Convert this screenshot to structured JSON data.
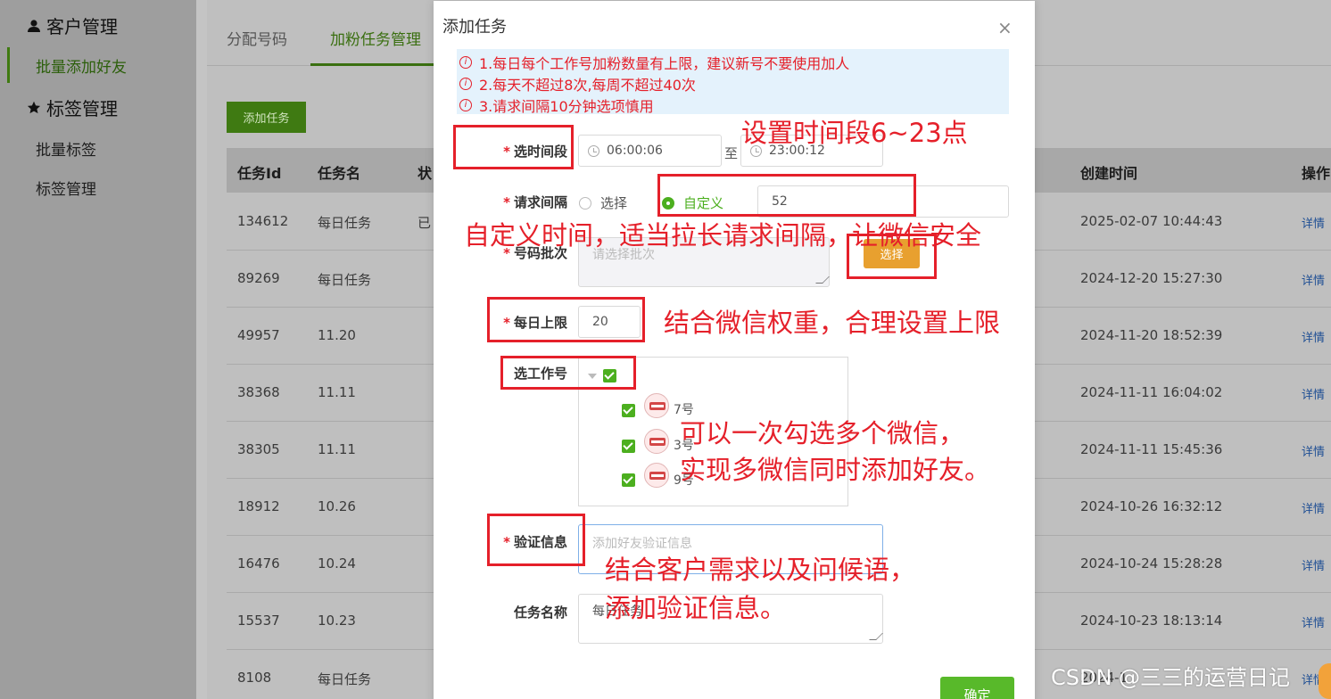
{
  "sidebar": {
    "groups": [
      {
        "label": "客户管理",
        "icon": "user-icon",
        "items": [
          "批量添加好友"
        ]
      },
      {
        "label": "标签管理",
        "icon": "star-icon",
        "items": [
          "批量标签",
          "标签管理"
        ]
      }
    ],
    "active_item": "批量添加好友"
  },
  "tabs": [
    "分配号码",
    "加粉任务管理"
  ],
  "active_tab": "加粉任务管理",
  "toolbar": {
    "add_task_label": "添加任务"
  },
  "table": {
    "headers": {
      "id": "任务Id",
      "name": "任务名",
      "status": "状",
      "created": "创建时间",
      "action": "操作"
    },
    "rows": [
      {
        "id": "134612",
        "name": "每日任务",
        "status": "已",
        "created": "2025-02-07 10:44:43",
        "action": "详情"
      },
      {
        "id": "89269",
        "name": "每日任务",
        "status": "",
        "created": "2024-12-20 15:27:30",
        "action": "详情"
      },
      {
        "id": "49957",
        "name": "11.20",
        "status": "",
        "created": "2024-11-20 18:52:39",
        "action": "详情"
      },
      {
        "id": "38368",
        "name": "11.11",
        "status": "",
        "created": "2024-11-11 16:04:02",
        "action": "详情"
      },
      {
        "id": "38305",
        "name": "11.11",
        "status": "",
        "created": "2024-11-11 15:45:36",
        "action": "详情"
      },
      {
        "id": "18912",
        "name": "10.26",
        "status": "",
        "created": "2024-10-26 16:32:12",
        "action": "详情"
      },
      {
        "id": "16476",
        "name": "10.24",
        "status": "",
        "created": "2024-10-24 15:28:28",
        "action": "详情"
      },
      {
        "id": "15537",
        "name": "10.23",
        "status": "",
        "created": "2024-10-23 18:13:14",
        "action": "详情"
      },
      {
        "id": "8108",
        "name": "每日任务",
        "status": "",
        "created": "2024-1",
        "action": "详情"
      }
    ]
  },
  "modal": {
    "title": "添加任务",
    "close_icon": "close-icon",
    "notices": [
      "1.每日每个工作号加粉数量有上限，建议新号不要使用加人",
      "2.每天不超过8次,每周不超过40次",
      "3.请求间隔10分钟选项慎用"
    ],
    "fields": {
      "time_range": {
        "label": "选时间段",
        "start": "06:00:06",
        "separator": "至",
        "end": "23:00:12"
      },
      "interval": {
        "label": "请求间隔",
        "option_select": "选择",
        "option_custom": "自定义",
        "value": "52"
      },
      "batch": {
        "label": "号码批次",
        "placeholder": "请选择批次",
        "button": "选择"
      },
      "daily_limit": {
        "label": "每日上限",
        "value": "20"
      },
      "accounts": {
        "label": "选工作号",
        "items": [
          "7号",
          "3号",
          "9号"
        ]
      },
      "verify": {
        "label": "验证信息",
        "placeholder": "添加好友验证信息"
      },
      "task_name": {
        "label": "任务名称",
        "value": "每日任务"
      }
    },
    "confirm_label": "确定"
  },
  "annotations": [
    "设置时间段6~23点",
    "自定义时间，适当拉长请求间隔，让微信安全",
    "结合微信权重，合理设置上限",
    "可以一次勾选多个微信，",
    "实现多微信同时添加好友。",
    "结合客户需求以及问候语，",
    "添加验证信息。"
  ],
  "watermark": "CSDN @三三的运营日记",
  "colors": {
    "accent_green": "#4caf1f",
    "annotation_red": "#e5202a",
    "choose_orange": "#e8a02f"
  }
}
